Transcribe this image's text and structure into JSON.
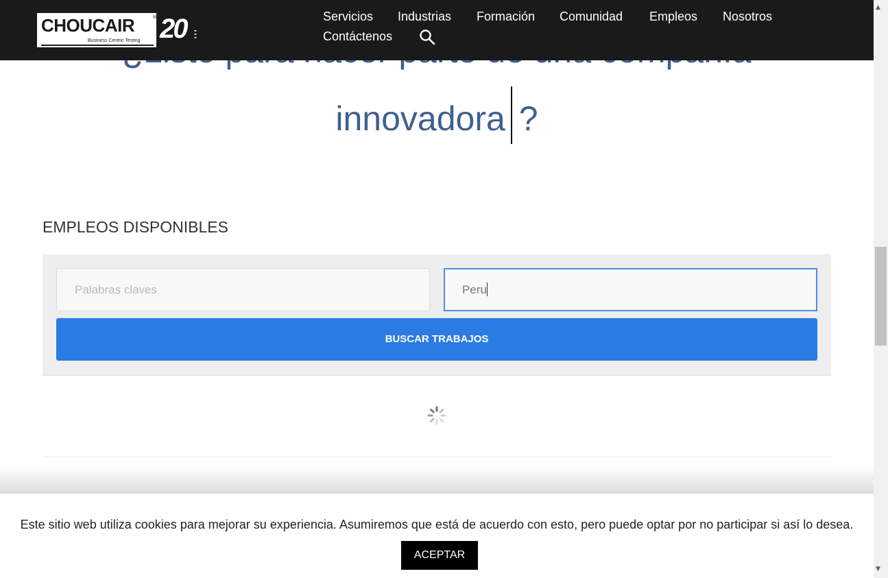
{
  "header": {
    "logo_text": "CHOUCAIR",
    "logo_tagline": "Business Centric Testing",
    "anniversary_badge": "20",
    "nav": [
      "Servicios",
      "Industrias",
      "Formación",
      "Comunidad",
      "Empleos",
      "Nosotros",
      "Contáctenos"
    ]
  },
  "hero": {
    "line1": "¿Listo para hacer parte de una compañía",
    "typed_word": "innovadora",
    "suffix": "?"
  },
  "jobs": {
    "title": "EMPLEOS DISPONIBLES",
    "keywords_placeholder": "Palabras claves",
    "location_value": "Peru",
    "search_button": "BUSCAR TRABAJOS"
  },
  "cookie": {
    "message": "Este sitio web utiliza cookies para mejorar su experiencia. Asumiremos que está de acuerdo con esto, pero puede optar por no participar si así lo desea.",
    "accept_button": "ACEPTAR"
  },
  "colors": {
    "header_bg": "#1a1a1a",
    "hero_text": "#3f5f8f",
    "button_blue": "#2a7be4",
    "focus_border": "#4a90e2"
  },
  "icons": [
    "search-icon",
    "loading-spinner-icon"
  ]
}
